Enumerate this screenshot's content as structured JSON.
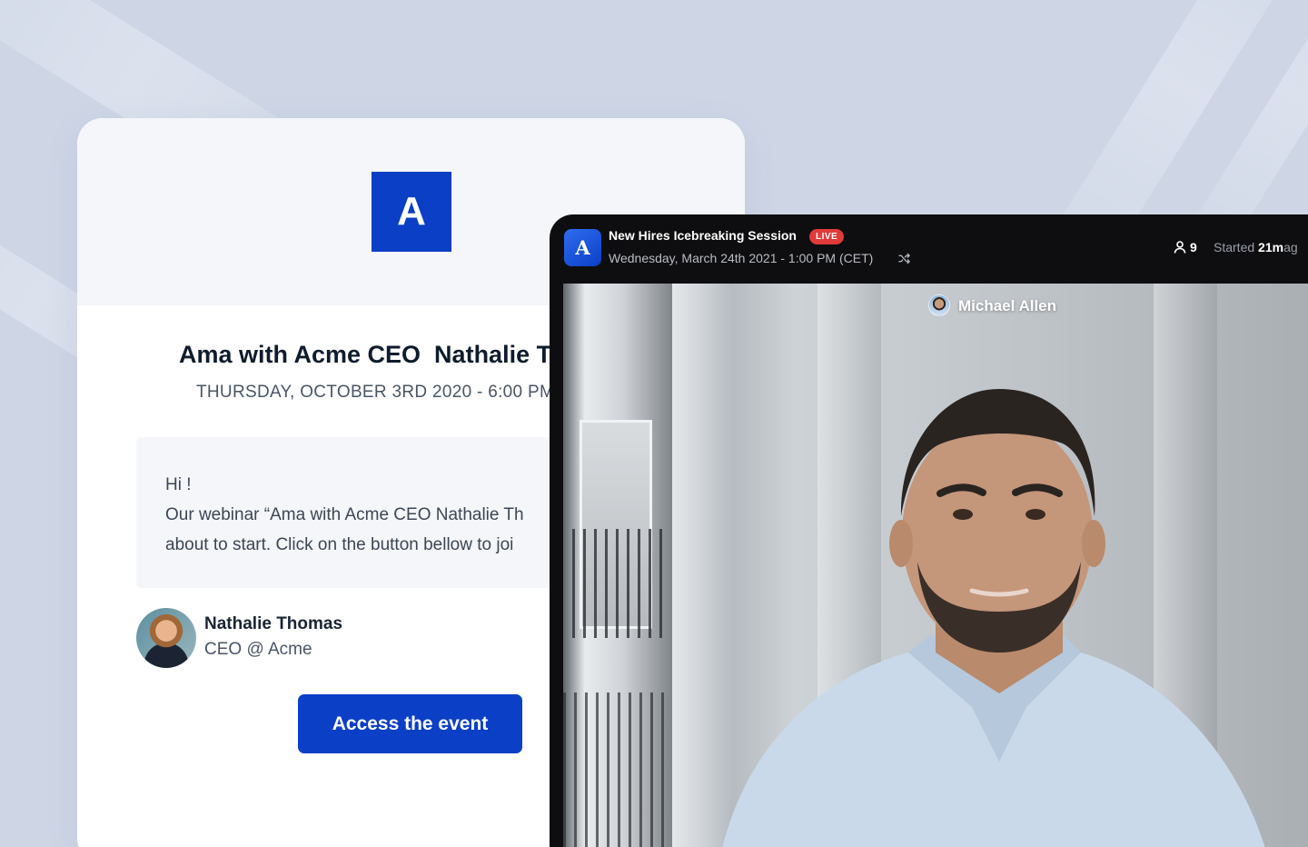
{
  "email": {
    "logo_letter": "A",
    "title": "Ama with Acme CEO  Nathalie T",
    "date": "THURSDAY, OCTOBER 3RD 2020 - 6:00 PM",
    "message": {
      "greeting": "Hi !",
      "line1": "Our webinar “Ama with Acme CEO Nathalie Th",
      "line2": "about to start. Click on the button bellow to joi"
    },
    "speaker": {
      "name": "Nathalie Thomas",
      "role": "CEO @ Acme"
    },
    "cta_label": "Access the event"
  },
  "stream": {
    "logo_letter": "A",
    "session_title": "New Hires Icebreaking Session",
    "live_label": "LIVE",
    "session_date": "Wednesday, March 24th 2021 - 1:00 PM (CET)",
    "attendee_count": "9",
    "started_prefix": "Started",
    "started_value": "21m",
    "started_suffix": "ag",
    "participant_name": "Michael Allen"
  },
  "colors": {
    "brand": "#0b3fc6",
    "live": "#e03a3a",
    "background": "#ced6e6"
  }
}
